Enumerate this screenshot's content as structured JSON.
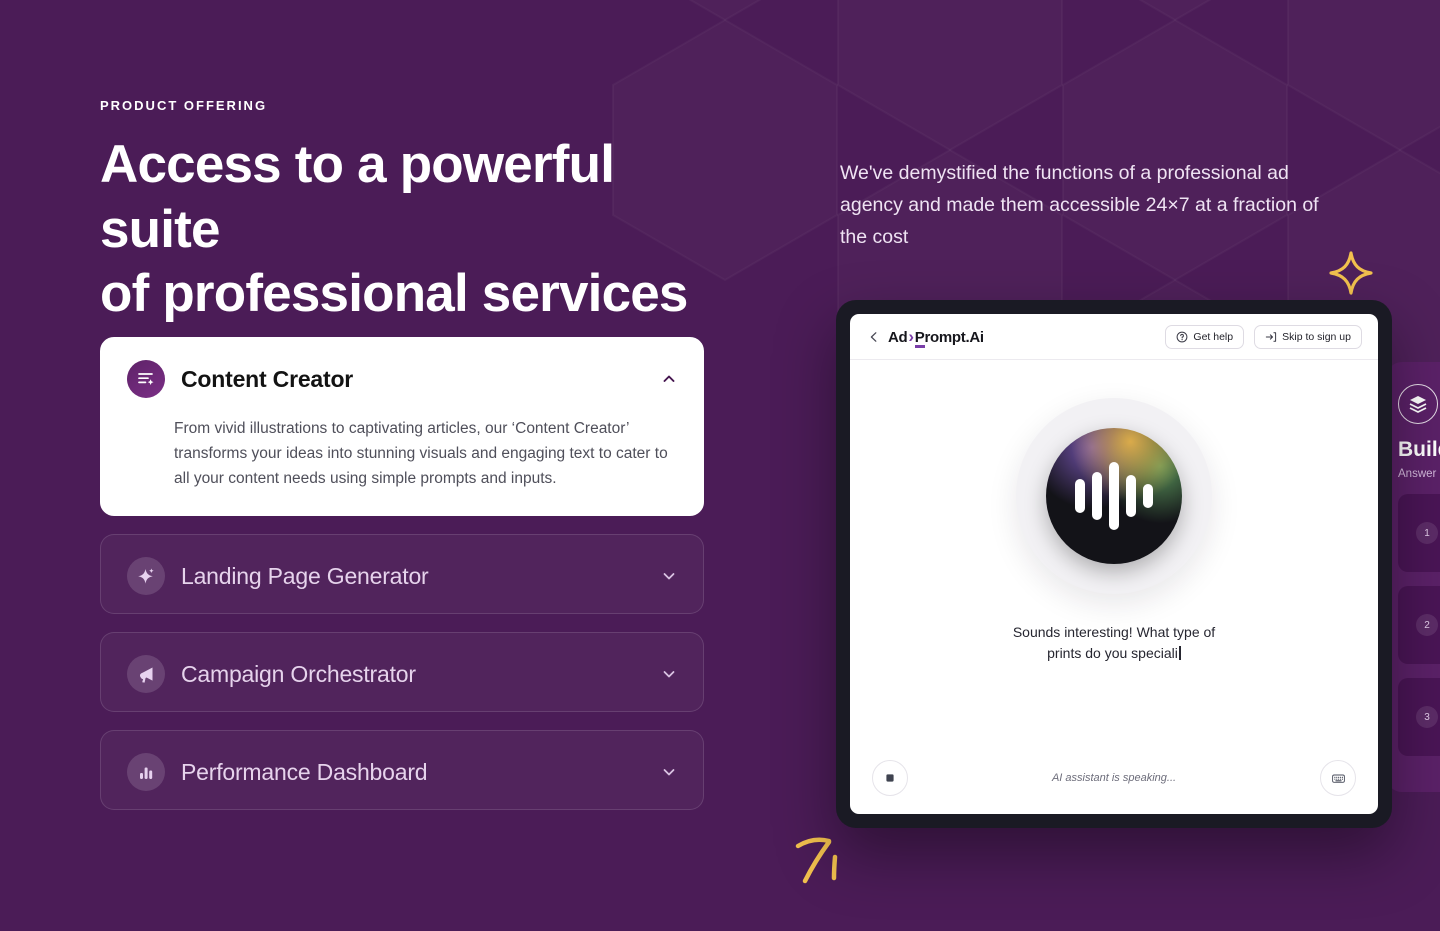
{
  "theme": {
    "background": "#4b1c57",
    "accent_purple": "#7a3ea8",
    "gold": "#f2c14e",
    "card_white": "#ffffff",
    "device_bezel": "#1a1a24"
  },
  "left": {
    "eyebrow": "PRODUCT OFFERING",
    "headline_line1": "Access to a powerful suite",
    "headline_line2": "of professional services"
  },
  "right": {
    "paragraph": "We've demystified the functions of a professional ad agency and made them accessible 24×7 at a fraction of the cost"
  },
  "accordion": {
    "items": [
      {
        "title": "Content Creator",
        "icon": "text-lines-sparkle-icon",
        "expanded": true,
        "chevron": "chevron-up-icon",
        "body": "From vivid illustrations to captivating articles, our ‘Content Creator’ transforms your ideas into stunning visuals and engaging text to cater to all your content needs using simple prompts and inputs."
      },
      {
        "title": "Landing Page Generator",
        "icon": "sparkles-icon",
        "expanded": false,
        "chevron": "chevron-down-icon",
        "body": ""
      },
      {
        "title": "Campaign Orchestrator",
        "icon": "megaphone-icon",
        "expanded": false,
        "chevron": "chevron-down-icon",
        "body": ""
      },
      {
        "title": "Performance Dashboard",
        "icon": "bar-chart-icon",
        "expanded": false,
        "chevron": "chevron-down-icon",
        "body": ""
      }
    ]
  },
  "device": {
    "topbar": {
      "back_icon": "chevron-left-icon",
      "logo_prefix": "Ad",
      "logo_chevron": "›",
      "logo_p": "P",
      "logo_suffix": "rompt.Ai",
      "get_help_label": "Get help",
      "get_help_icon": "question-circle-icon",
      "skip_label": "Skip to sign up",
      "skip_icon": "login-arrow-icon"
    },
    "main": {
      "orb_icon": "voice-waveform-icon",
      "waveform_bar_heights": [
        34,
        48,
        68,
        42,
        24
      ],
      "caption": "Sounds interesting! What type of prints do you speciali",
      "caret_visible": true
    },
    "bottombar": {
      "stop_icon": "stop-square-icon",
      "status": "AI assistant is speaking...",
      "keyboard_icon": "keyboard-icon"
    }
  },
  "side_panel": {
    "badge_icon": "layers-icon",
    "title": "Build",
    "subtitle": "Answer",
    "cards": [
      {
        "number": "1"
      },
      {
        "number": "2"
      },
      {
        "number": "3"
      }
    ]
  },
  "decorations": {
    "star_icon": "four-point-star-icon",
    "squiggle_icon": "hand-drawn-seven-icon"
  }
}
